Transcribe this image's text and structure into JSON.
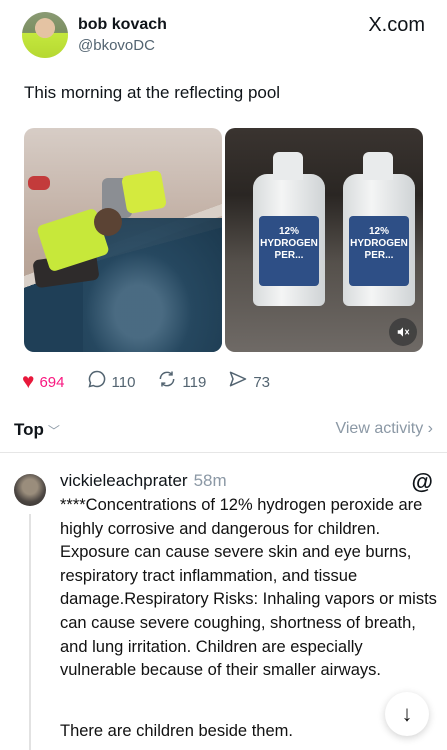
{
  "post": {
    "display_name": "bob kovach",
    "handle": "@bkovoDC",
    "source_label": "X.com",
    "text": "This morning at the reflecting pool",
    "media": {
      "jug_label": "12% HYDROGEN PER..."
    },
    "metrics": {
      "likes": "694",
      "replies": "110",
      "reposts": "119",
      "shares": "73"
    }
  },
  "sort": {
    "label": "Top",
    "view_activity": "View activity"
  },
  "reply": {
    "username": "vickieleachprater",
    "time": "58m",
    "paragraph1": "****Concentrations of 12% hydrogen peroxide are highly corrosive and dangerous for children. Exposure can cause severe skin and eye burns, respiratory tract inflammation, and tissue damage.Respiratory Risks: Inhaling vapors or mists can cause severe coughing, shortness of breath, and lung irritation. Children are especially vulnerable because of their smaller airways.",
    "paragraph2": "There are children beside them."
  },
  "icons": {
    "heart": "heart-icon",
    "reply": "reply-icon",
    "repost": "repost-icon",
    "share": "share-icon",
    "mute": "mute-icon",
    "threads": "threads-icon",
    "arrow_down": "arrow-down-icon"
  },
  "colors": {
    "like": "#e8183b",
    "muted_text": "#8b98a5",
    "hi_vis_vest": "#c7e83a"
  }
}
